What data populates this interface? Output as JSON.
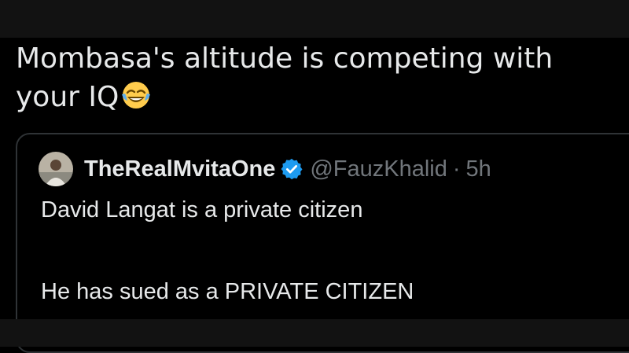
{
  "post": {
    "text": "Mombasa's altitude is competing with your IQ",
    "emoji": "face-with-tears-of-joy-icon"
  },
  "quote": {
    "display_name": "TheRealMvitaOne",
    "handle": "@FauzKhalid",
    "separator": "·",
    "time": "5h",
    "lines": [
      "David Langat is a private citizen",
      "He has sued as a PRIVATE CITIZEN"
    ]
  },
  "colors": {
    "background": "#000000",
    "band": "#121212",
    "text": "#e7e9ea",
    "secondary_text": "#71767b",
    "border": "#2f3336",
    "verified": "#1d9bf0"
  }
}
